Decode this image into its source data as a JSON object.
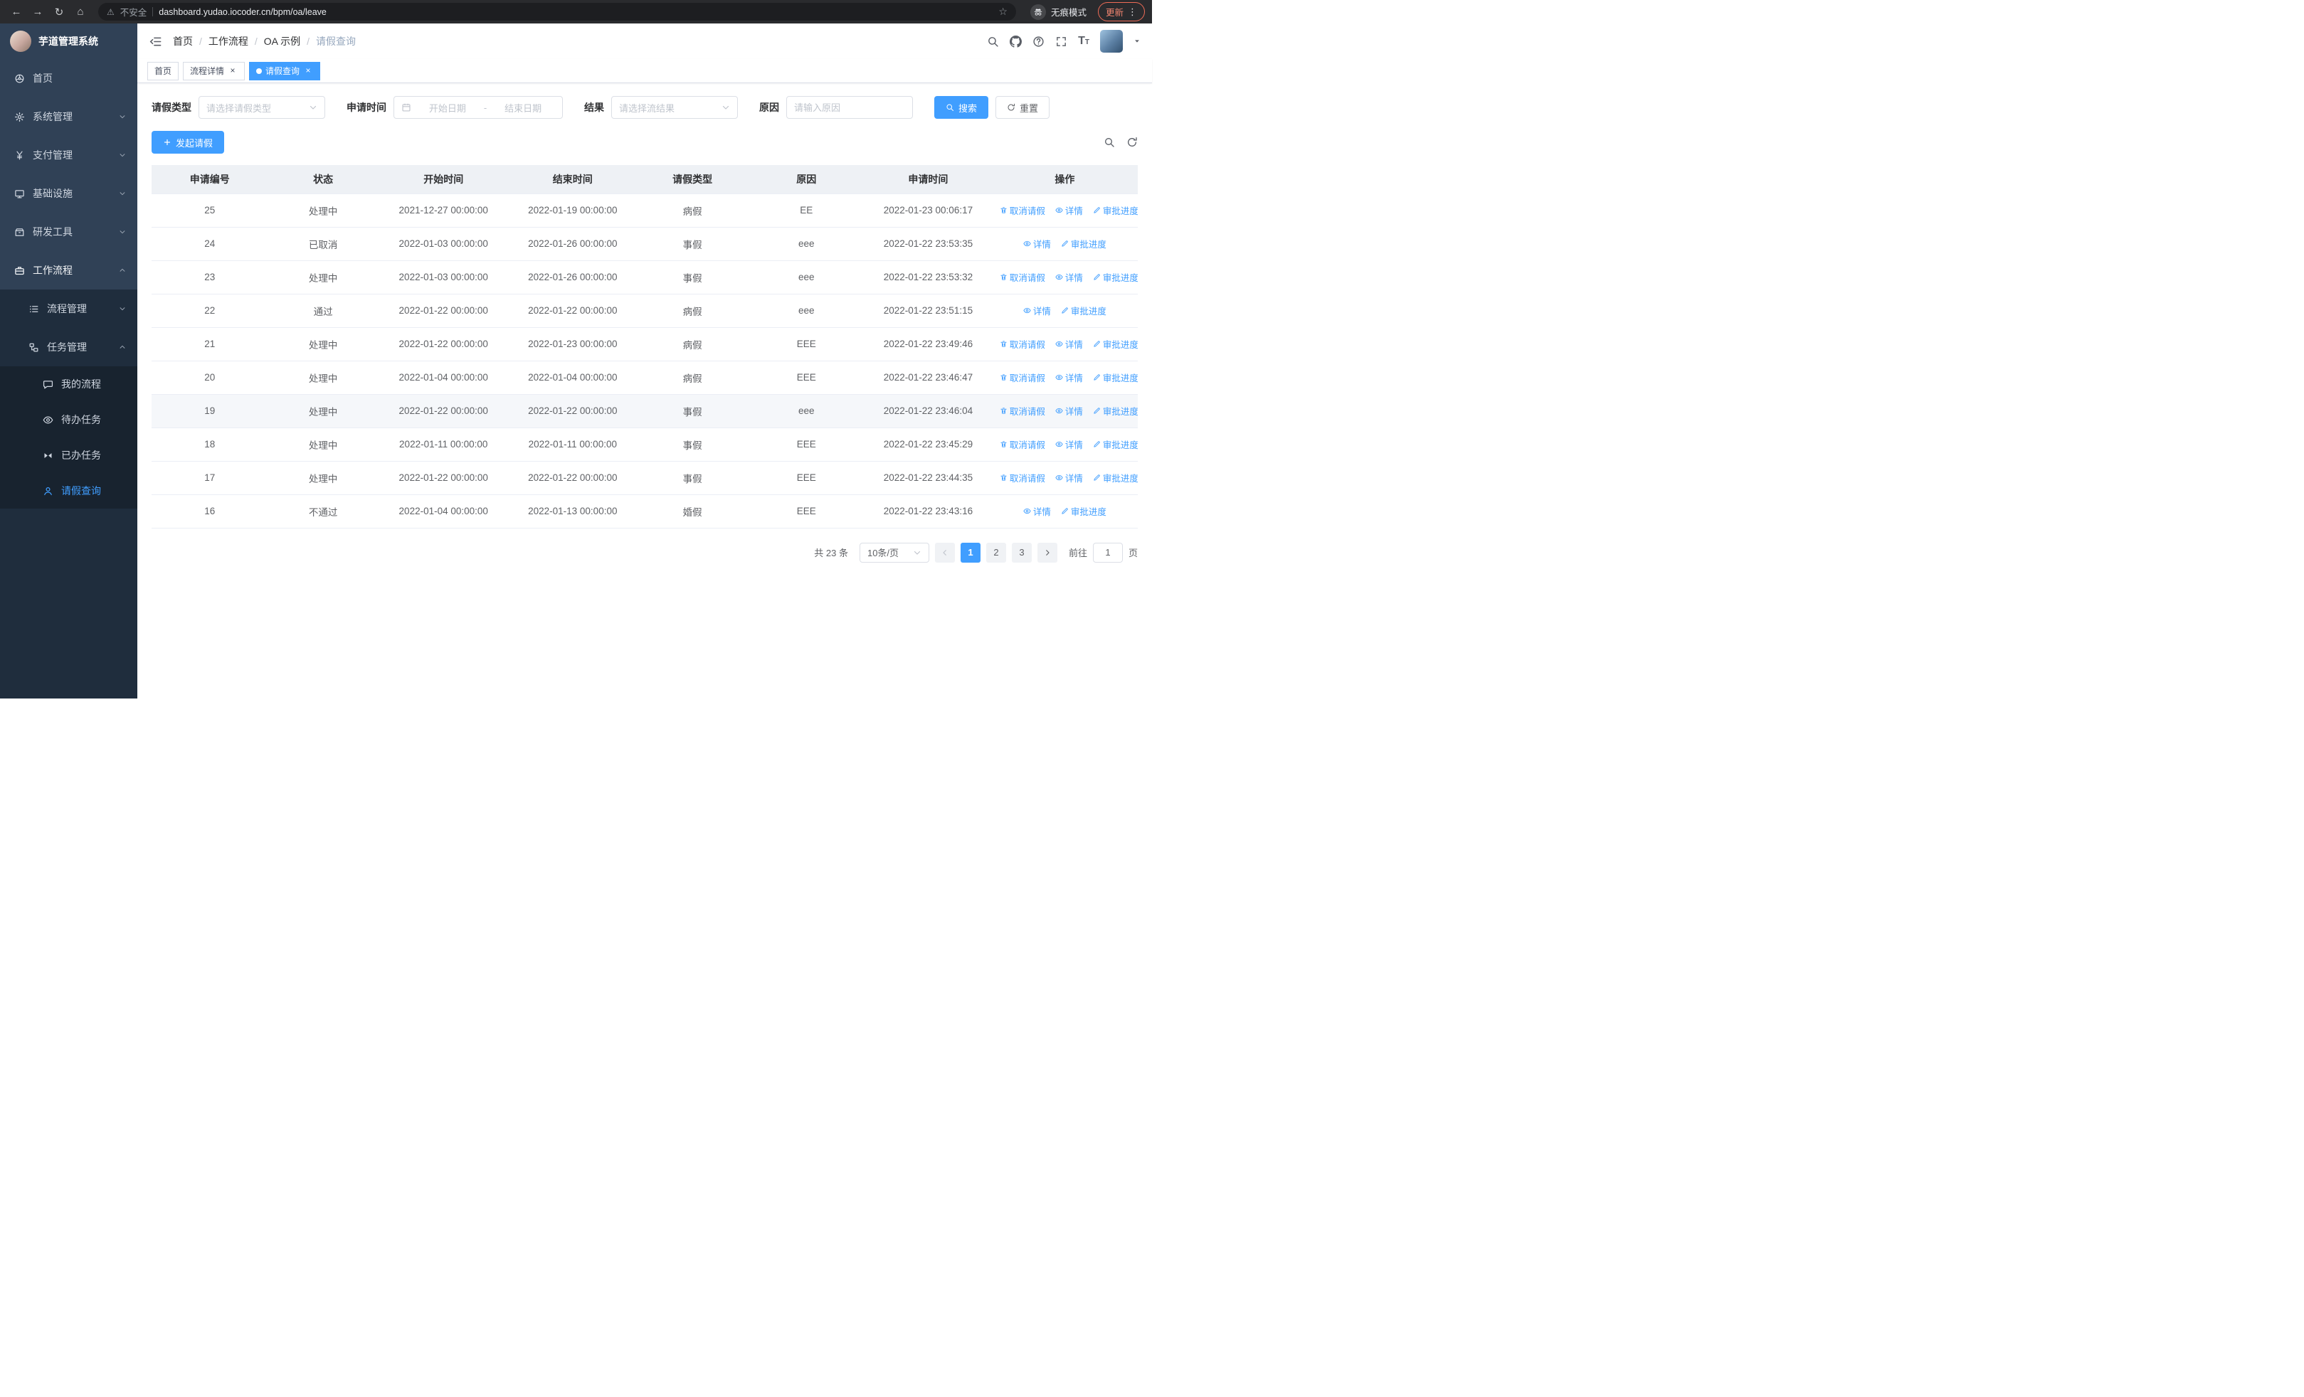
{
  "browser": {
    "security_label": "不安全",
    "url": "dashboard.yudao.iocoder.cn/bpm/oa/leave",
    "incognito_label": "无痕模式",
    "update_label": "更新"
  },
  "sidebar": {
    "logo_title": "芋道管理系统",
    "items": [
      {
        "label": "首页"
      },
      {
        "label": "系统管理"
      },
      {
        "label": "支付管理"
      },
      {
        "label": "基础设施"
      },
      {
        "label": "研发工具"
      },
      {
        "label": "工作流程"
      }
    ],
    "workflow_children": [
      {
        "label": "流程管理"
      },
      {
        "label": "任务管理"
      }
    ],
    "task_children": [
      {
        "label": "我的流程"
      },
      {
        "label": "待办任务"
      },
      {
        "label": "已办任务"
      },
      {
        "label": "请假查询"
      }
    ]
  },
  "navbar": {
    "breadcrumb": {
      "separator": "/",
      "items": [
        "首页",
        "工作流程",
        "OA 示例",
        "请假查询"
      ]
    }
  },
  "tabs": {
    "items": [
      {
        "label": "首页"
      },
      {
        "label": "流程详情",
        "closable": true
      },
      {
        "label": "请假查询",
        "closable": true,
        "active": true
      }
    ]
  },
  "filters": {
    "leave_type": {
      "label": "请假类型",
      "placeholder": "请选择请假类型"
    },
    "apply_time": {
      "label": "申请时间",
      "start_placeholder": "开始日期",
      "separator": "-",
      "end_placeholder": "结束日期"
    },
    "result": {
      "label": "结果",
      "placeholder": "请选择流结果"
    },
    "reason": {
      "label": "原因",
      "placeholder": "请输入原因"
    },
    "search_label": "搜索",
    "reset_label": "重置"
  },
  "toolbar": {
    "create_label": "发起请假"
  },
  "table": {
    "columns": [
      "申请编号",
      "状态",
      "开始时间",
      "结束时间",
      "请假类型",
      "原因",
      "申请时间",
      "操作"
    ],
    "column_keys": [
      "id",
      "status",
      "start_time",
      "end_time",
      "leave_type",
      "reason",
      "apply_time"
    ],
    "actions_def": {
      "cancel": {
        "label": "取消请假",
        "icon": "trash-icon"
      },
      "detail": {
        "label": "详情",
        "icon": "eye-icon"
      },
      "progress": {
        "label": "审批进度",
        "icon": "pen-icon"
      }
    },
    "rows": [
      {
        "id": "25",
        "status": "处理中",
        "start_time": "2021-12-27 00:00:00",
        "end_time": "2022-01-19 00:00:00",
        "leave_type": "病假",
        "reason": "EE",
        "apply_time": "2022-01-23 00:06:17",
        "actions": [
          "cancel",
          "detail",
          "progress"
        ]
      },
      {
        "id": "24",
        "status": "已取消",
        "start_time": "2022-01-03 00:00:00",
        "end_time": "2022-01-26 00:00:00",
        "leave_type": "事假",
        "reason": "eee",
        "apply_time": "2022-01-22 23:53:35",
        "actions": [
          "detail",
          "progress"
        ]
      },
      {
        "id": "23",
        "status": "处理中",
        "start_time": "2022-01-03 00:00:00",
        "end_time": "2022-01-26 00:00:00",
        "leave_type": "事假",
        "reason": "eee",
        "apply_time": "2022-01-22 23:53:32",
        "actions": [
          "cancel",
          "detail",
          "progress"
        ]
      },
      {
        "id": "22",
        "status": "通过",
        "start_time": "2022-01-22 00:00:00",
        "end_time": "2022-01-22 00:00:00",
        "leave_type": "病假",
        "reason": "eee",
        "apply_time": "2022-01-22 23:51:15",
        "actions": [
          "detail",
          "progress"
        ]
      },
      {
        "id": "21",
        "status": "处理中",
        "start_time": "2022-01-22 00:00:00",
        "end_time": "2022-01-23 00:00:00",
        "leave_type": "病假",
        "reason": "EEE",
        "apply_time": "2022-01-22 23:49:46",
        "actions": [
          "cancel",
          "detail",
          "progress"
        ]
      },
      {
        "id": "20",
        "status": "处理中",
        "start_time": "2022-01-04 00:00:00",
        "end_time": "2022-01-04 00:00:00",
        "leave_type": "病假",
        "reason": "EEE",
        "apply_time": "2022-01-22 23:46:47",
        "actions": [
          "cancel",
          "detail",
          "progress"
        ]
      },
      {
        "id": "19",
        "status": "处理中",
        "start_time": "2022-01-22 00:00:00",
        "end_time": "2022-01-22 00:00:00",
        "leave_type": "事假",
        "reason": "eee",
        "apply_time": "2022-01-22 23:46:04",
        "actions": [
          "cancel",
          "detail",
          "progress"
        ],
        "highlighted": true
      },
      {
        "id": "18",
        "status": "处理中",
        "start_time": "2022-01-11 00:00:00",
        "end_time": "2022-01-11 00:00:00",
        "leave_type": "事假",
        "reason": "EEE",
        "apply_time": "2022-01-22 23:45:29",
        "actions": [
          "cancel",
          "detail",
          "progress"
        ]
      },
      {
        "id": "17",
        "status": "处理中",
        "start_time": "2022-01-22 00:00:00",
        "end_time": "2022-01-22 00:00:00",
        "leave_type": "事假",
        "reason": "EEE",
        "apply_time": "2022-01-22 23:44:35",
        "actions": [
          "cancel",
          "detail",
          "progress"
        ]
      },
      {
        "id": "16",
        "status": "不通过",
        "start_time": "2022-01-04 00:00:00",
        "end_time": "2022-01-13 00:00:00",
        "leave_type": "婚假",
        "reason": "EEE",
        "apply_time": "2022-01-22 23:43:16",
        "actions": [
          "detail",
          "progress"
        ]
      }
    ]
  },
  "pagination": {
    "total_text": "共 23 条",
    "page_size": "10条/页",
    "pages": [
      "1",
      "2",
      "3"
    ],
    "active_page": "1",
    "goto_label": "前往",
    "goto_value": "1",
    "goto_suffix": "页"
  },
  "colors": {
    "primary": "#409eff",
    "sidebar_bg": "#304156",
    "submenu_bg": "#1f2d3d",
    "update_pill": "#ef6c57"
  }
}
